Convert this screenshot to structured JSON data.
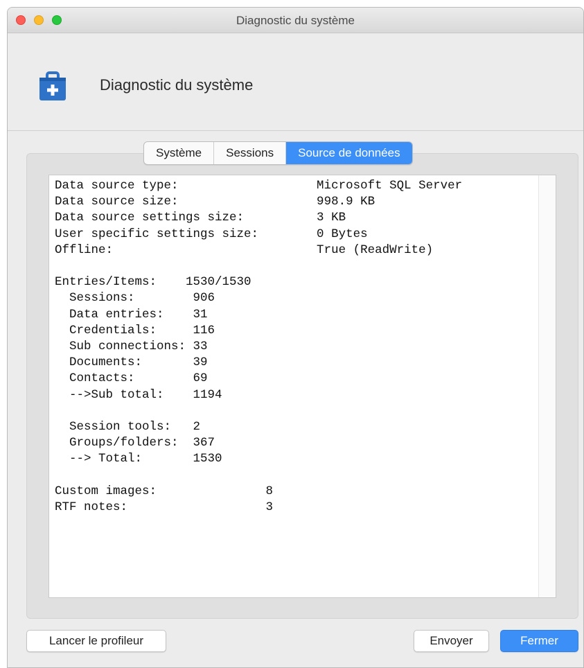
{
  "window": {
    "title": "Diagnostic du système"
  },
  "header": {
    "title": "Diagnostic du système",
    "icon": "medical-kit-icon"
  },
  "tabs": [
    {
      "label": "Système",
      "active": false
    },
    {
      "label": "Sessions",
      "active": false
    },
    {
      "label": "Source de données",
      "active": true
    }
  ],
  "diagnostic": {
    "lines": [
      "Data source type:                   Microsoft SQL Server",
      "Data source size:                   998.9 KB",
      "Data source settings size:          3 KB",
      "User specific settings size:        0 Bytes",
      "Offline:                            True (ReadWrite)",
      "",
      "Entries/Items:    1530/1530",
      "  Sessions:        906",
      "  Data entries:    31",
      "  Credentials:     116",
      "  Sub connections: 33",
      "  Documents:       39",
      "  Contacts:        69",
      "  -->Sub total:    1194",
      "",
      "  Session tools:   2",
      "  Groups/folders:  367",
      "  --> Total:       1530",
      "",
      "Custom images:               8",
      "RTF notes:                   3"
    ]
  },
  "buttons": {
    "profiler": "Lancer le profileur",
    "send": "Envoyer",
    "close": "Fermer"
  },
  "colors": {
    "accent": "#3b8ff6",
    "header_icon": "#2f73c8"
  }
}
